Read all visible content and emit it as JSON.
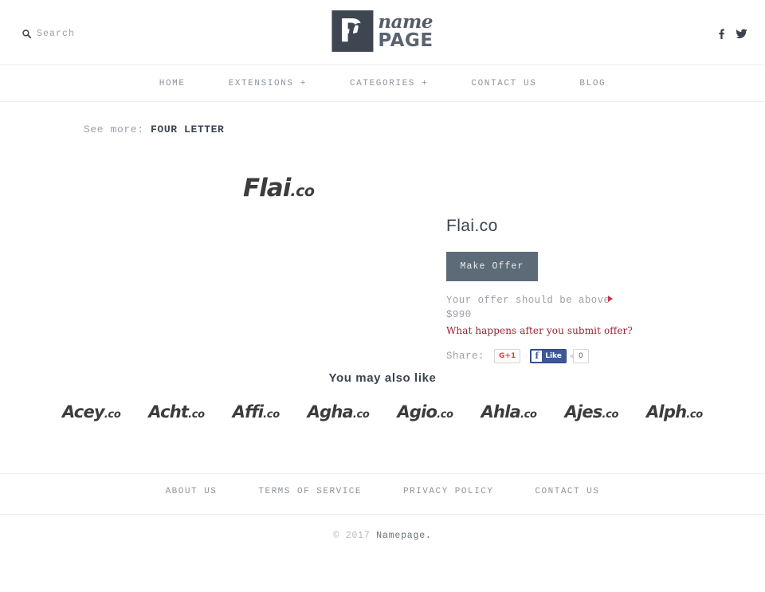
{
  "header": {
    "search": {
      "label": "Search",
      "icon": "search-icon"
    },
    "logo": {
      "mark_letter": "P",
      "mark_script": "n",
      "name": "name",
      "page": "PAGE"
    },
    "social": [
      {
        "name": "facebook-icon",
        "label": "f"
      },
      {
        "name": "twitter-icon",
        "label": "twitter"
      }
    ]
  },
  "nav": {
    "items": [
      {
        "label": "HOME"
      },
      {
        "label": "EXTENSIONS +"
      },
      {
        "label": "CATEGORIES +"
      },
      {
        "label": "CONTACT US"
      },
      {
        "label": "BLOG"
      }
    ]
  },
  "see_more": {
    "label": "See more:",
    "link": "FOUR LETTER"
  },
  "listing": {
    "art_name": "Flai",
    "art_tld": ".co",
    "title": "Flai.co",
    "make_offer_label": "Make Offer",
    "offer_note": "Your offer should be above $990",
    "minimum_offer": "$990",
    "help_link": "What happens after you submit offer?",
    "share_label": "Share:",
    "gplus_label": "G+1",
    "fb_f": "f",
    "fb_like_label": "Like",
    "fb_count": "0"
  },
  "also_like": {
    "title": "You may also like",
    "items": [
      {
        "name": "Acey",
        "tld": ".co"
      },
      {
        "name": "Acht",
        "tld": ".co"
      },
      {
        "name": "Affi",
        "tld": ".co"
      },
      {
        "name": "Agha",
        "tld": ".co"
      },
      {
        "name": "Agio",
        "tld": ".co"
      },
      {
        "name": "Ahla",
        "tld": ".co"
      },
      {
        "name": "Ajes",
        "tld": ".co"
      },
      {
        "name": "Alph",
        "tld": ".co"
      }
    ]
  },
  "footer": {
    "links": [
      {
        "label": "ABOUT US"
      },
      {
        "label": "TERMS OF SERVICE"
      },
      {
        "label": "PRIVACY POLICY"
      },
      {
        "label": "CONTACT US"
      }
    ],
    "copyright_year": "© 2017",
    "copyright_name": "Namepage."
  },
  "colors": {
    "accent_button": "#5d6b78",
    "accent_red": "#9b2233",
    "arrow_red": "#c9304a",
    "text_dark": "#3c4450",
    "text_muted": "#9ba1a8",
    "divider": "#ececec"
  }
}
